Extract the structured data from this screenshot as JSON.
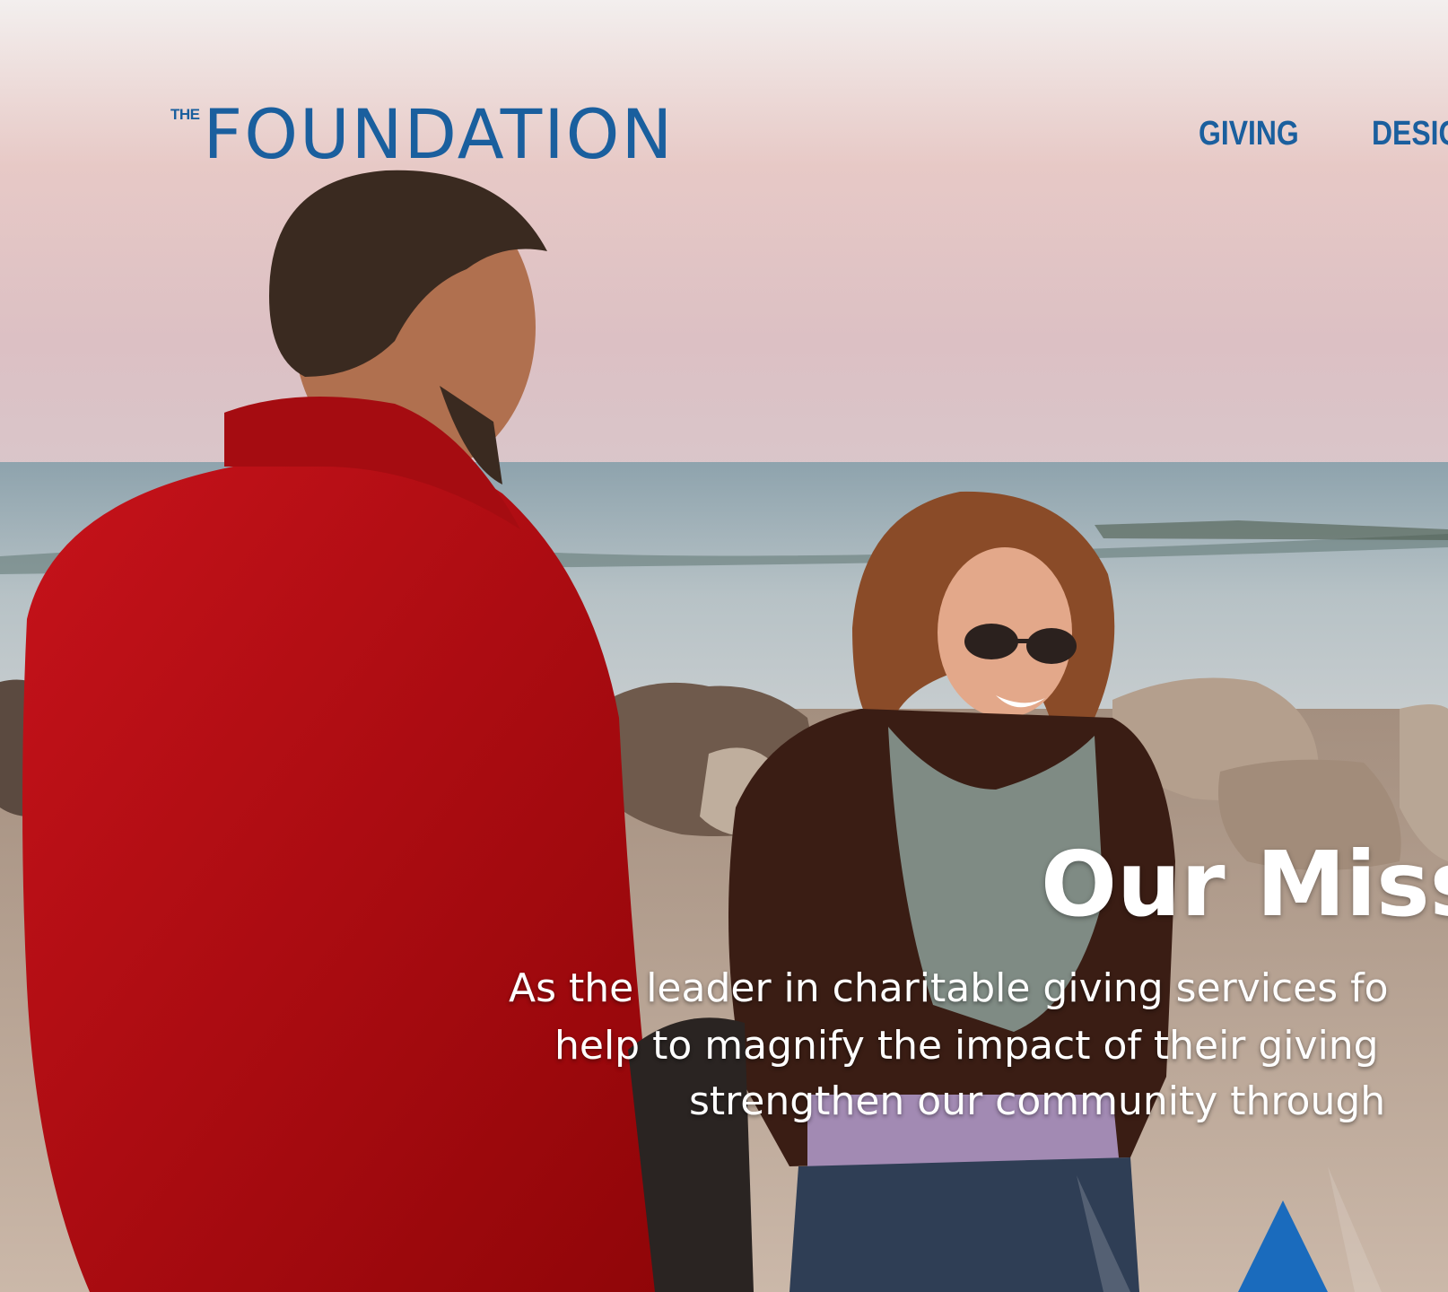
{
  "brand": {
    "logo_prefix": "THE",
    "logo_word": "FOUNDATION",
    "color": "#1a5f9e"
  },
  "nav": {
    "items": [
      "GIVING",
      "DESIG"
    ]
  },
  "hero": {
    "title": "Our Miss",
    "lines": [
      "As the leader in charitable giving services fo",
      "help to magnify the impact of their giving",
      "strengthen our community through"
    ],
    "photo_description_icon": "photo-icon"
  }
}
